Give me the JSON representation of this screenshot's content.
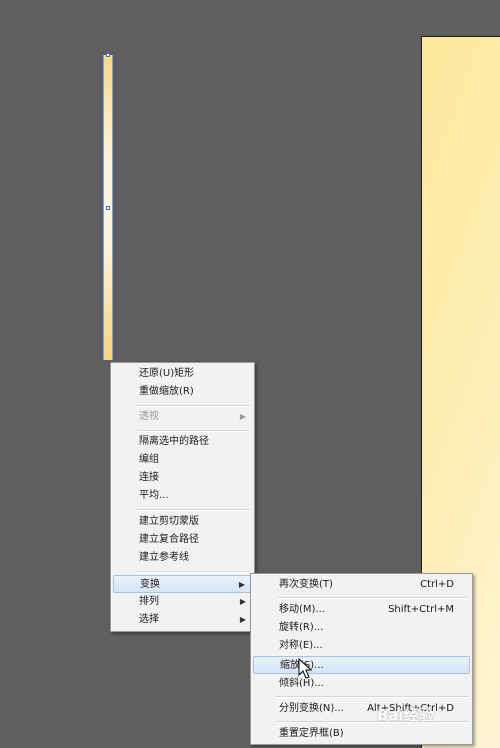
{
  "context_menu": {
    "items": [
      {
        "label": "还原(U)矩形"
      },
      {
        "label": "重做缩放(R)"
      },
      {
        "label": "透视",
        "disabled": true
      },
      {
        "label": "隔离选中的路径"
      },
      {
        "label": "编组"
      },
      {
        "label": "连接"
      },
      {
        "label": "平均..."
      },
      {
        "label": "建立剪切蒙版"
      },
      {
        "label": "建立复合路径"
      },
      {
        "label": "建立参考线"
      },
      {
        "label": "变换",
        "highlighted": true
      },
      {
        "label": "排列"
      },
      {
        "label": "选择"
      }
    ]
  },
  "submenu": {
    "items": [
      {
        "label": "再次变换(T)",
        "shortcut": "Ctrl+D"
      },
      {
        "label": "移动(M)...",
        "shortcut": "Shift+Ctrl+M"
      },
      {
        "label": "旋转(R)..."
      },
      {
        "label": "对称(E)..."
      },
      {
        "label": "缩放(S)...",
        "highlighted": true
      },
      {
        "label": "倾斜(H)..."
      },
      {
        "label": "分别变换(N)...",
        "shortcut": "Alt+Shift+Ctrl+D"
      },
      {
        "label": "重置定界框(B)"
      }
    ]
  },
  "watermark": {
    "text": "Bai经验"
  },
  "colors": {
    "canvas": "#5f5f5f",
    "artboard": "#fde79a",
    "menu_bg": "#f2f2f2",
    "highlight": "#d6e4f6"
  }
}
